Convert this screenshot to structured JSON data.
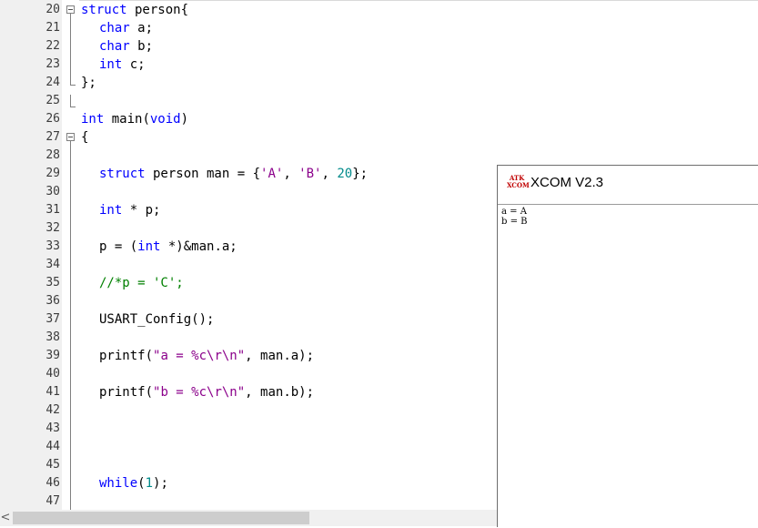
{
  "editor": {
    "lines": [
      {
        "num": "20",
        "tokens": [
          {
            "t": "struct person{",
            "c": "kw-mixed"
          }
        ]
      },
      {
        "num": "21",
        "tokens": []
      },
      {
        "num": "22",
        "tokens": []
      },
      {
        "num": "23",
        "tokens": []
      },
      {
        "num": "24",
        "tokens": []
      },
      {
        "num": "25",
        "tokens": []
      },
      {
        "num": "26",
        "tokens": []
      },
      {
        "num": "27",
        "tokens": []
      },
      {
        "num": "28",
        "tokens": []
      },
      {
        "num": "29",
        "tokens": []
      },
      {
        "num": "30",
        "tokens": []
      },
      {
        "num": "31",
        "tokens": []
      },
      {
        "num": "32",
        "tokens": []
      },
      {
        "num": "33",
        "tokens": []
      },
      {
        "num": "34",
        "tokens": []
      },
      {
        "num": "35",
        "tokens": []
      },
      {
        "num": "36",
        "tokens": []
      },
      {
        "num": "37",
        "tokens": []
      },
      {
        "num": "38",
        "tokens": []
      },
      {
        "num": "39",
        "tokens": []
      },
      {
        "num": "40",
        "tokens": []
      },
      {
        "num": "41",
        "tokens": []
      },
      {
        "num": "42",
        "tokens": []
      },
      {
        "num": "43",
        "tokens": []
      },
      {
        "num": "44",
        "tokens": []
      },
      {
        "num": "45",
        "tokens": []
      },
      {
        "num": "46",
        "tokens": []
      },
      {
        "num": "47",
        "tokens": []
      }
    ],
    "code": {
      "l20_kw": "struct",
      "l20_rest": " person{",
      "l21_kw": "char",
      "l21_rest": " a;",
      "l22_kw": "char",
      "l22_rest": " b;",
      "l23_kw": "int",
      "l23_rest": " c;",
      "l24": "};",
      "l26_kw": "int",
      "l26_mid": " main(",
      "l26_kw2": "void",
      "l26_end": ")",
      "l27": "{",
      "l29_kw": "struct",
      "l29_a": " person man = {",
      "l29_s1": "'A'",
      "l29_b": ", ",
      "l29_s2": "'B'",
      "l29_c": ", ",
      "l29_n": "20",
      "l29_d": "};",
      "l31_kw": "int",
      "l31_rest": " * p;",
      "l33_a": "p = (",
      "l33_kw": "int",
      "l33_b": " *)&man.a;",
      "l35": "//*p = 'C';",
      "l37": "USART_Config();",
      "l39_a": "printf(",
      "l39_s": "\"a = %c\\r\\n\"",
      "l39_b": ", man.a);",
      "l41_a": "printf(",
      "l41_s": "\"b = %c\\r\\n\"",
      "l41_b": ", man.b);",
      "l46_kw": "while",
      "l46_a": "(",
      "l46_n": "1",
      "l46_b": ");"
    }
  },
  "scrollbar": {
    "left_arrow": "<"
  },
  "xcom": {
    "logo_top": "ATK",
    "logo_bottom": "XCOM",
    "title": "XCOM V2.3",
    "received": [
      "a = A",
      "b = B"
    ]
  }
}
